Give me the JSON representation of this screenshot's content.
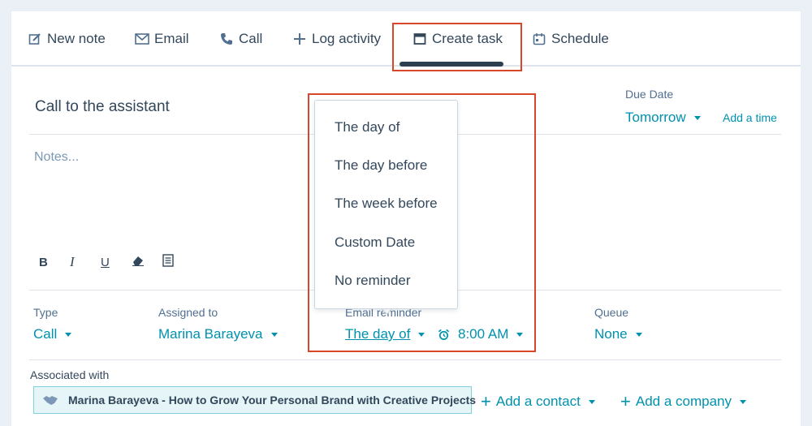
{
  "tabs": [
    {
      "label": "New note",
      "icon": "edit-icon"
    },
    {
      "label": "Email",
      "icon": "envelope-icon"
    },
    {
      "label": "Call",
      "icon": "phone-icon"
    },
    {
      "label": "Log activity",
      "icon": "plus-icon"
    },
    {
      "label": "Create task",
      "icon": "task-icon"
    },
    {
      "label": "Schedule",
      "icon": "calendar-icon"
    }
  ],
  "task": {
    "title": "Call to the assistant",
    "notes_placeholder": "Notes..."
  },
  "due": {
    "label": "Due Date",
    "value": "Tomorrow",
    "add_time": "Add a time"
  },
  "toolbar": {
    "bold": "B",
    "italic": "I",
    "underline": "U"
  },
  "fields": {
    "type_label": "Type",
    "type_value": "Call",
    "assigned_label": "Assigned to",
    "assigned_value": "Marina Barayeva",
    "reminder_label": "Email reminder",
    "reminder_value": "The day of",
    "reminder_time": "8:00 AM",
    "queue_label": "Queue",
    "queue_value": "None"
  },
  "association": {
    "label": "Associated with",
    "chip": "Marina Barayeva - How to Grow Your Personal Brand with Creative Projects",
    "add_contact": "Add a contact",
    "add_company": "Add a company"
  },
  "reminder_dropdown": {
    "options": [
      "The day of",
      "The day before",
      "The week before",
      "Custom Date",
      "No reminder"
    ]
  },
  "colors": {
    "accent": "#0091ae",
    "highlight": "#d8472a",
    "text": "#33475b"
  }
}
